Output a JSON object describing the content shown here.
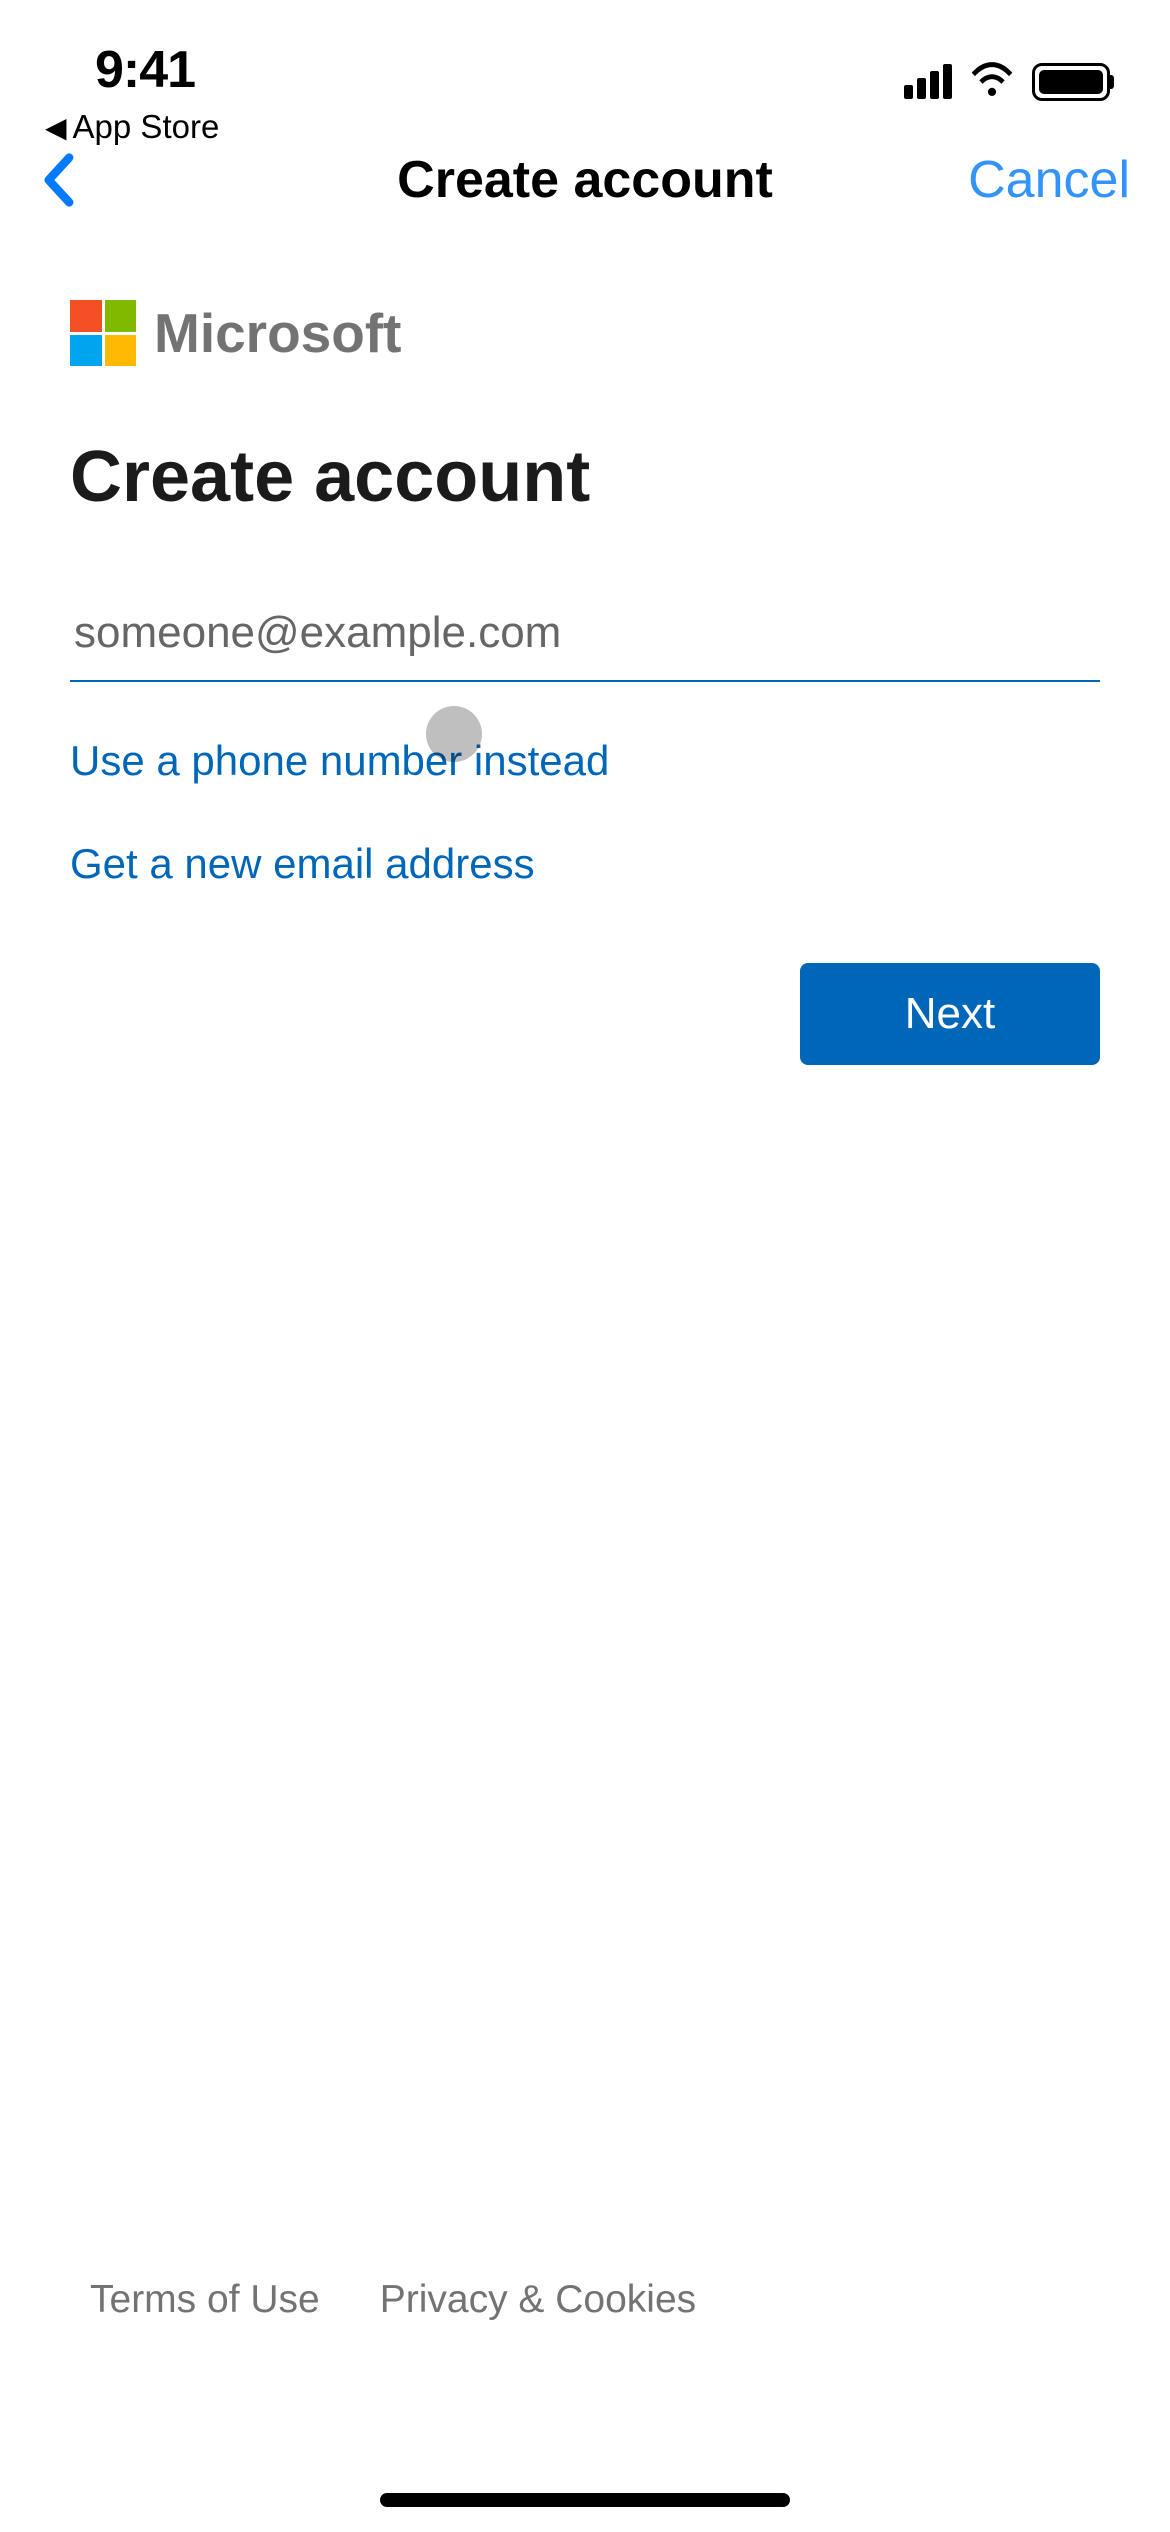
{
  "status_bar": {
    "time": "9:41",
    "back_app": "App Store"
  },
  "nav": {
    "title": "Create account",
    "cancel": "Cancel"
  },
  "brand": {
    "name": "Microsoft"
  },
  "page": {
    "heading": "Create account"
  },
  "form": {
    "email_value": "",
    "email_placeholder": "someone@example.com",
    "phone_link": "Use a phone number instead",
    "new_email_link": "Get a new email address",
    "next_button": "Next"
  },
  "footer": {
    "terms": "Terms of Use",
    "privacy": "Privacy & Cookies"
  },
  "colors": {
    "accent": "#0067B8",
    "ios_blue": "#007AFF"
  }
}
